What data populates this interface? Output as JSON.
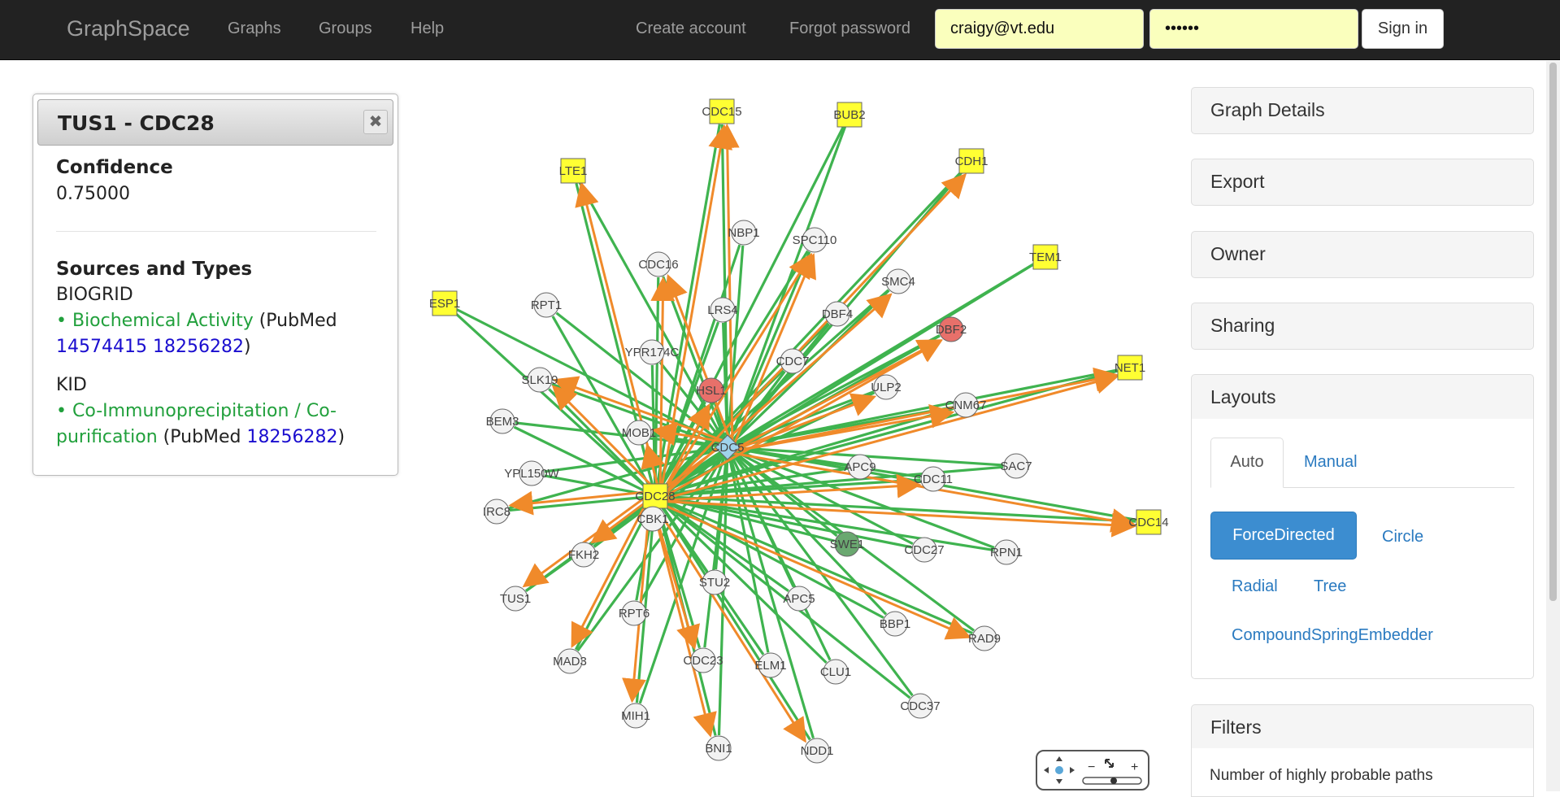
{
  "navbar": {
    "brand": "GraphSpace",
    "links": [
      "Graphs",
      "Groups",
      "Help"
    ],
    "create_account": "Create account",
    "forgot_password": "Forgot password",
    "email_value": "craigy@vt.edu",
    "password_value": "••••••",
    "sign_in": "Sign in"
  },
  "edge_panel": {
    "title": "TUS1 - CDC28",
    "close_icon": "close-icon",
    "confidence_label": "Confidence",
    "confidence_value": "0.75000",
    "sources_label": "Sources and Types",
    "source1_name": "BIOGRID",
    "source1_type": "• Biochemical Activity",
    "source1_pubmed_prefix": "(PubMed",
    "source1_pubmed_1": "14574415",
    "source1_pubmed_2": "18256282",
    "source1_pubmed_suffix": ")",
    "source2_name": "KID",
    "source2_type_line1": "• Co-Immunoprecipitation / Co-",
    "source2_type_line2": "purification",
    "source2_pubmed_prefix": "(PubMed",
    "source2_pubmed_1": "18256282",
    "source2_pubmed_suffix": ")"
  },
  "graph": {
    "colors": {
      "edge_green": "#3fb34f",
      "edge_orange": "#f08a2a",
      "node_yellow": "#ffff33",
      "node_white": "#f2f2f2",
      "node_red": "#e8706a",
      "node_darkgreen": "#6aa870",
      "node_hub": "#9fd3ec"
    },
    "nodes": [
      {
        "id": "CDC15",
        "shape": "square",
        "color": "yellow"
      },
      {
        "id": "BUB2",
        "shape": "square",
        "color": "yellow"
      },
      {
        "id": "CDH1",
        "shape": "square",
        "color": "yellow"
      },
      {
        "id": "LTE1",
        "shape": "square",
        "color": "yellow"
      },
      {
        "id": "TEM1",
        "shape": "square",
        "color": "yellow"
      },
      {
        "id": "ESP1",
        "shape": "square",
        "color": "yellow"
      },
      {
        "id": "NET1",
        "shape": "square",
        "color": "yellow"
      },
      {
        "id": "CDC14",
        "shape": "square",
        "color": "yellow"
      },
      {
        "id": "CDC28",
        "shape": "square",
        "color": "yellow"
      },
      {
        "id": "CDC5",
        "shape": "diamond",
        "color": "hub"
      },
      {
        "id": "NBP1",
        "shape": "circle",
        "color": "white"
      },
      {
        "id": "SPC110",
        "shape": "circle",
        "color": "white"
      },
      {
        "id": "CDC16",
        "shape": "circle",
        "color": "white"
      },
      {
        "id": "SMC4",
        "shape": "circle",
        "color": "white"
      },
      {
        "id": "RPT1",
        "shape": "circle",
        "color": "white"
      },
      {
        "id": "LRS4",
        "shape": "circle",
        "color": "white"
      },
      {
        "id": "DBF4",
        "shape": "circle",
        "color": "white"
      },
      {
        "id": "DBF2",
        "shape": "circle",
        "color": "red"
      },
      {
        "id": "YPR174C",
        "shape": "circle",
        "color": "white"
      },
      {
        "id": "CDC7",
        "shape": "circle",
        "color": "white"
      },
      {
        "id": "SLK19",
        "shape": "circle",
        "color": "white"
      },
      {
        "id": "HSL1",
        "shape": "circle",
        "color": "red"
      },
      {
        "id": "ULP2",
        "shape": "circle",
        "color": "white"
      },
      {
        "id": "CNM67",
        "shape": "circle",
        "color": "white"
      },
      {
        "id": "BEM3",
        "shape": "circle",
        "color": "white"
      },
      {
        "id": "MOB1",
        "shape": "circle",
        "color": "white"
      },
      {
        "id": "APC9",
        "shape": "circle",
        "color": "white"
      },
      {
        "id": "SAC7",
        "shape": "circle",
        "color": "white"
      },
      {
        "id": "YPL150W",
        "shape": "circle",
        "color": "white"
      },
      {
        "id": "CDC11",
        "shape": "circle",
        "color": "white"
      },
      {
        "id": "IRC8",
        "shape": "circle",
        "color": "white"
      },
      {
        "id": "CBK1",
        "shape": "circle",
        "color": "white"
      },
      {
        "id": "SWE1",
        "shape": "circle",
        "color": "darkgreen"
      },
      {
        "id": "CDC27",
        "shape": "circle",
        "color": "white"
      },
      {
        "id": "RPN1",
        "shape": "circle",
        "color": "white"
      },
      {
        "id": "FKH2",
        "shape": "circle",
        "color": "white"
      },
      {
        "id": "STU2",
        "shape": "circle",
        "color": "white"
      },
      {
        "id": "TUS1",
        "shape": "circle",
        "color": "white"
      },
      {
        "id": "APC5",
        "shape": "circle",
        "color": "white"
      },
      {
        "id": "RPT6",
        "shape": "circle",
        "color": "white"
      },
      {
        "id": "BBP1",
        "shape": "circle",
        "color": "white"
      },
      {
        "id": "RAD9",
        "shape": "circle",
        "color": "white"
      },
      {
        "id": "MAD3",
        "shape": "circle",
        "color": "white"
      },
      {
        "id": "CDC23",
        "shape": "circle",
        "color": "white"
      },
      {
        "id": "ELM1",
        "shape": "circle",
        "color": "white"
      },
      {
        "id": "CLU1",
        "shape": "circle",
        "color": "white"
      },
      {
        "id": "CDC37",
        "shape": "circle",
        "color": "white"
      },
      {
        "id": "MIH1",
        "shape": "circle",
        "color": "white"
      },
      {
        "id": "BNI1",
        "shape": "circle",
        "color": "white"
      },
      {
        "id": "NDD1",
        "shape": "circle",
        "color": "white"
      }
    ]
  },
  "zoom_control": {
    "icons": [
      "pan-icon",
      "zoom-out-icon",
      "fit-icon",
      "zoom-in-icon",
      "zoom-slider"
    ]
  },
  "sidebar": {
    "graph_details": "Graph Details",
    "export": "Export",
    "owner": "Owner",
    "sharing": "Sharing",
    "layouts": "Layouts",
    "tab_auto": "Auto",
    "tab_manual": "Manual",
    "layout_force": "ForceDirected",
    "layout_circle": "Circle",
    "layout_radial": "Radial",
    "layout_tree": "Tree",
    "layout_compound": "CompoundSpringEmbedder",
    "filters": "Filters",
    "filters_text": "Number of highly probable paths"
  }
}
